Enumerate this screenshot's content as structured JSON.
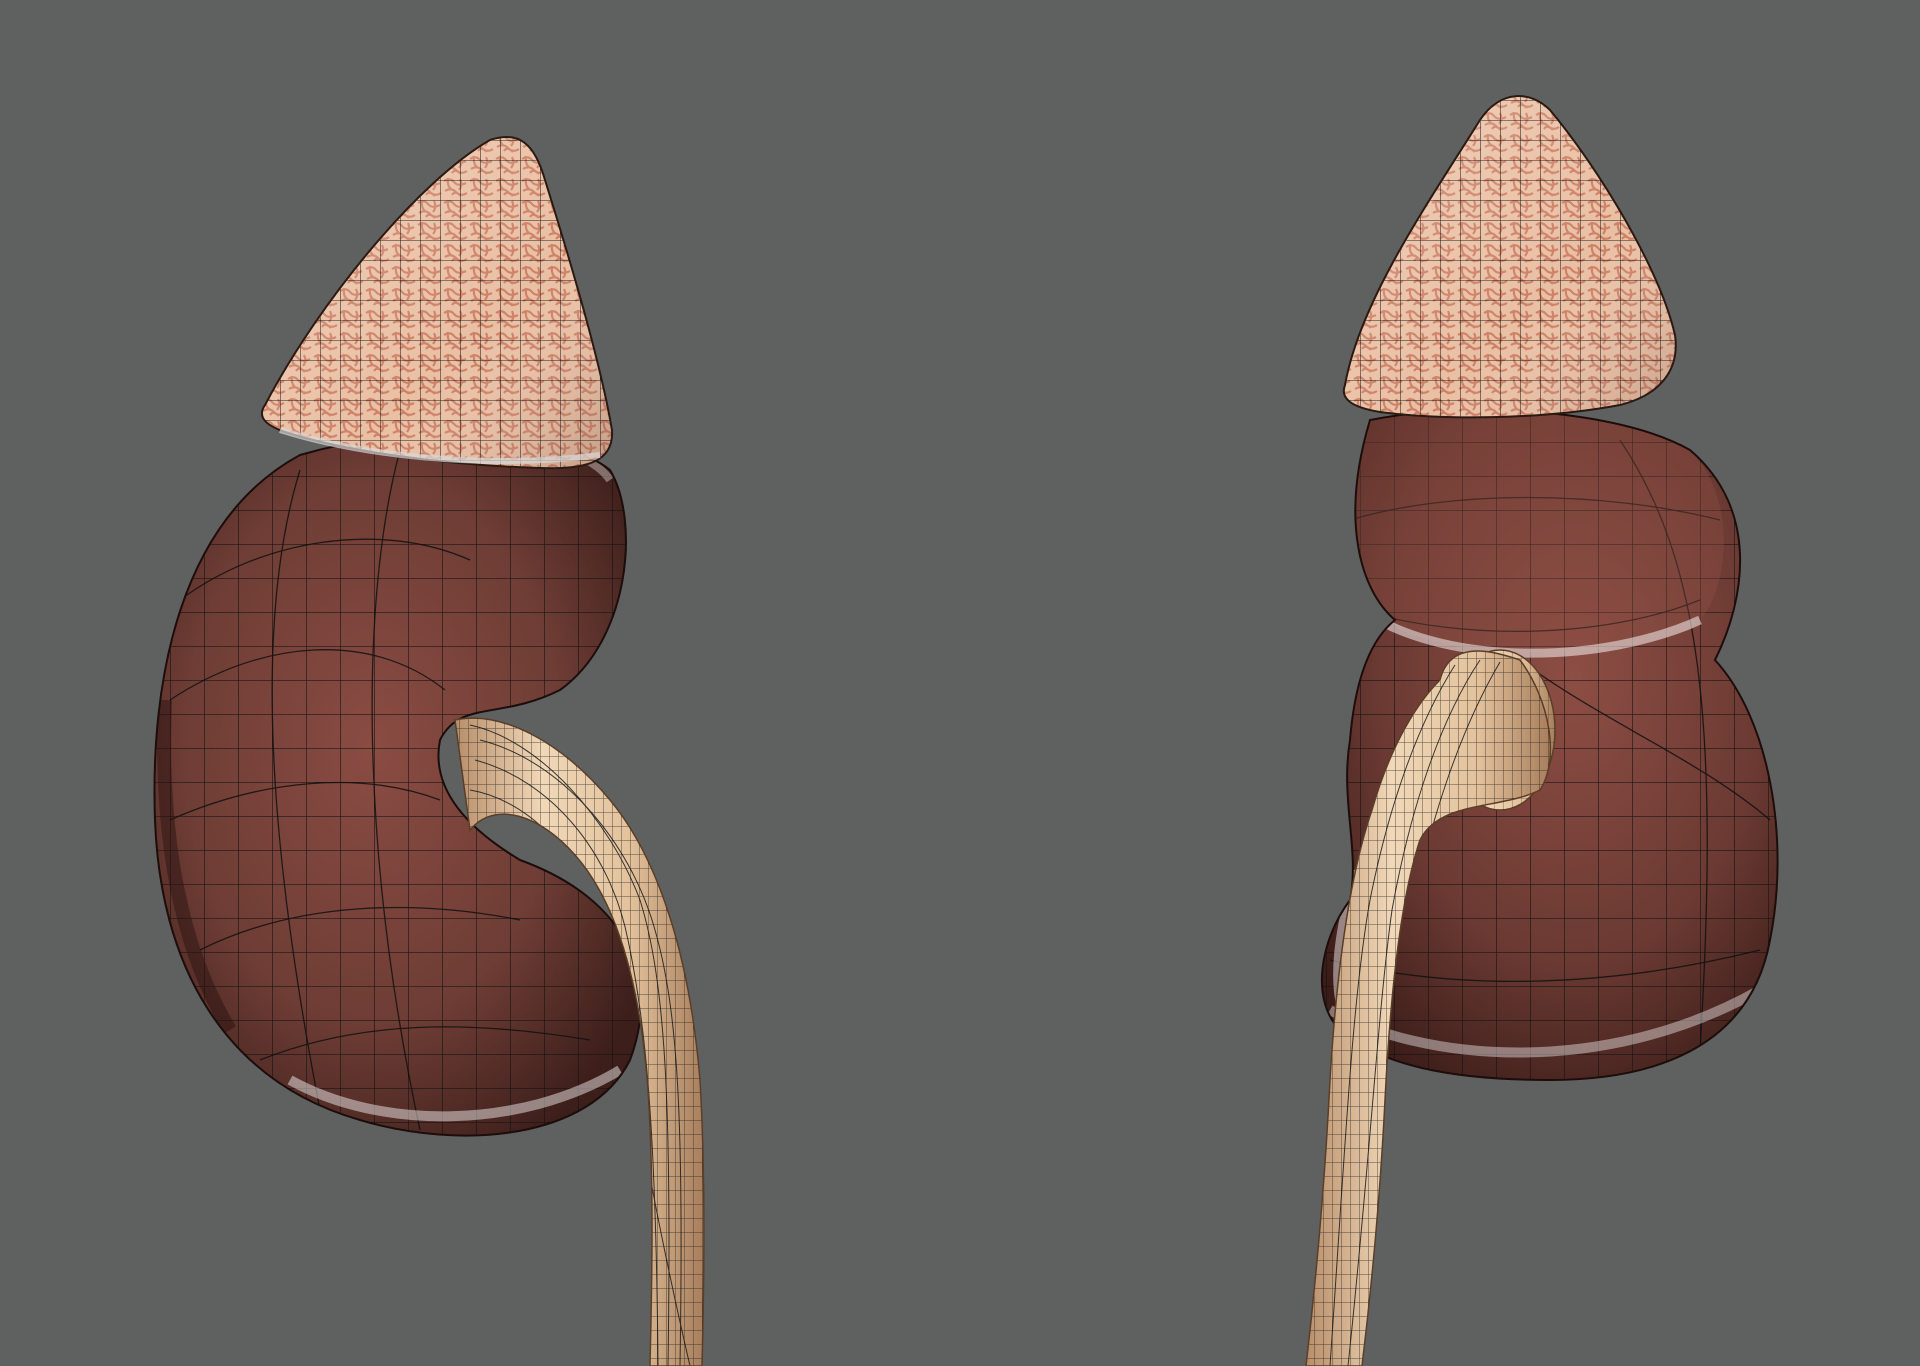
{
  "scene": {
    "background": "#5f6161",
    "objects": [
      {
        "name": "left-kidney",
        "view": "front",
        "parts": [
          "adrenal-gland",
          "kidney",
          "ureter"
        ]
      },
      {
        "name": "right-kidney",
        "view": "three-quarter",
        "parts": [
          "adrenal-gland",
          "kidney",
          "ureter"
        ]
      }
    ],
    "wireframe_overlay": true
  },
  "colors": {
    "kidney_base": "#6e3d35",
    "kidney_dark": "#3f1f1b",
    "kidney_light": "#9a5a4e",
    "adrenal_base": "#e7b79a",
    "adrenal_vein": "#c26a4e",
    "ureter_base": "#e8c8a4",
    "ureter_dark": "#b88e6a",
    "wire": "#111111"
  }
}
